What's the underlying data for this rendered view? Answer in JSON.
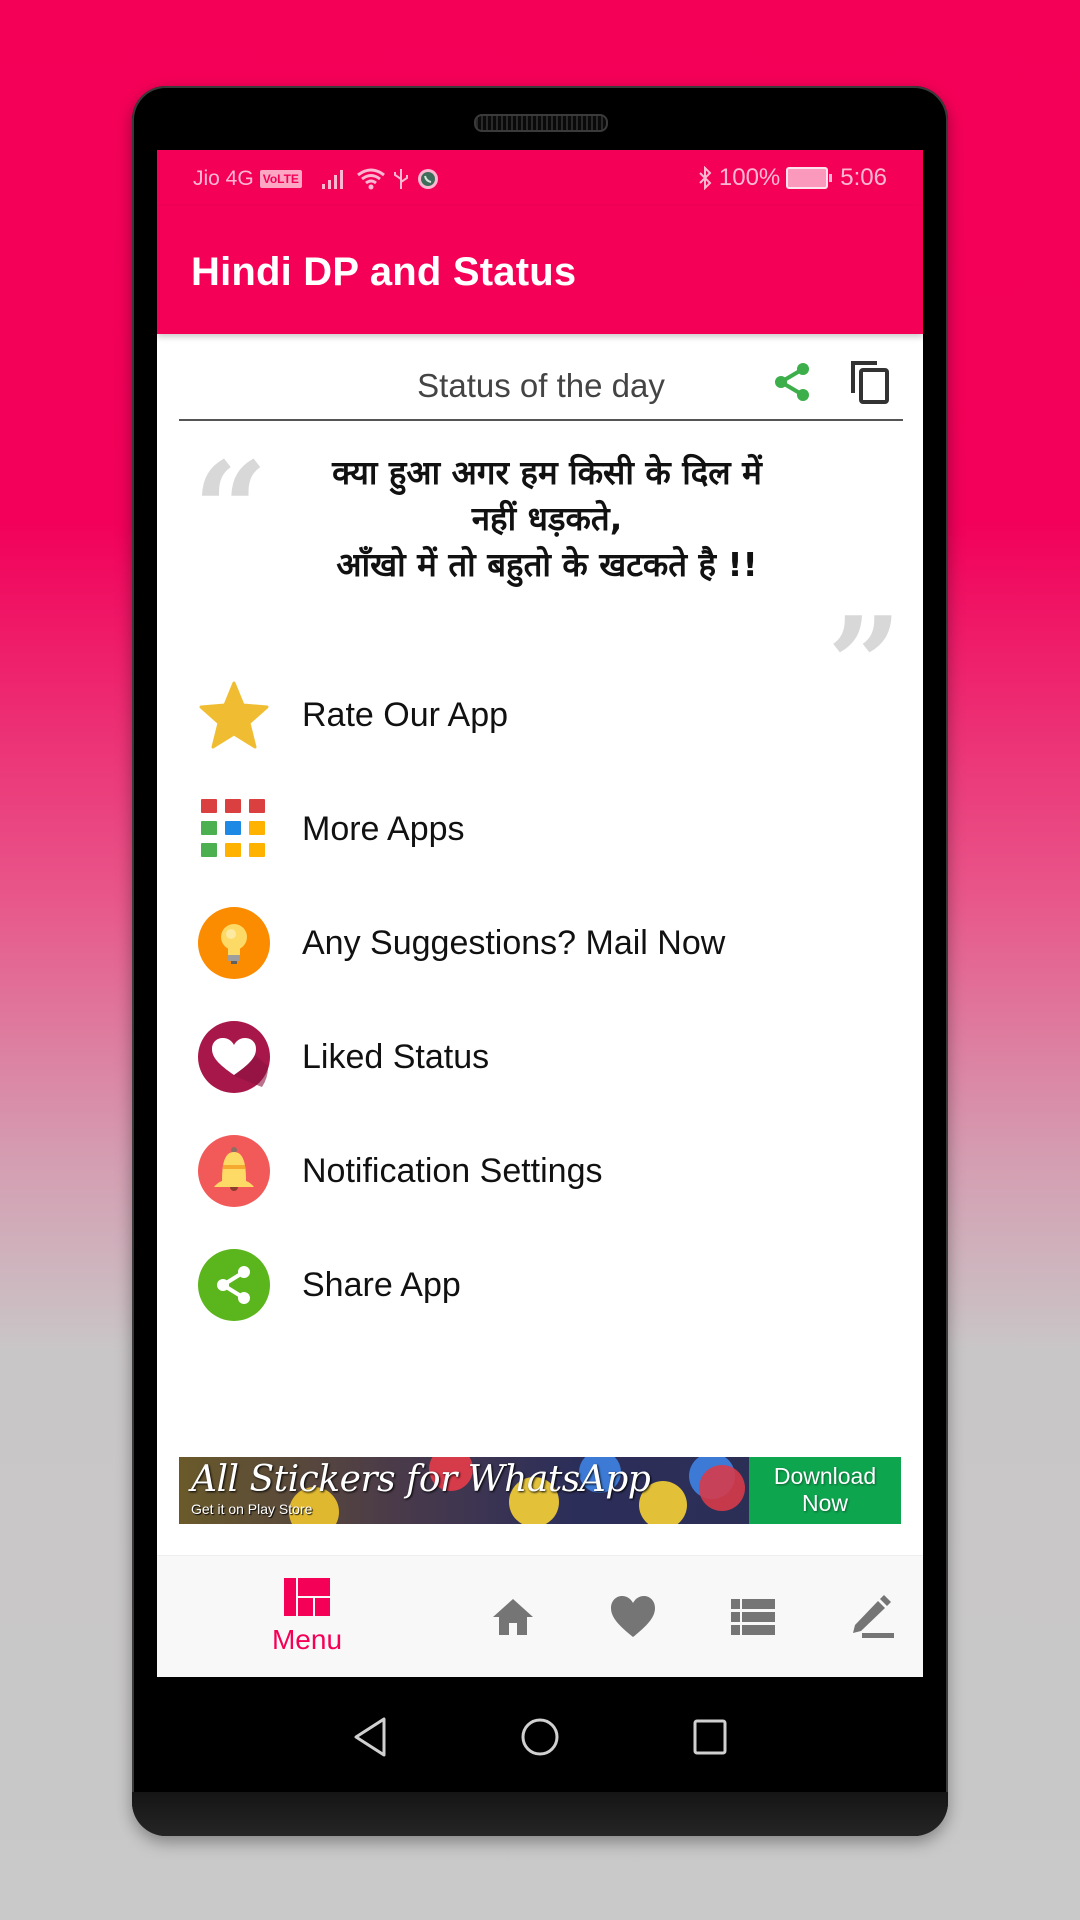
{
  "status_bar": {
    "carrier": "Jio 4G",
    "volte_badge": "VoLTE",
    "battery_text": "100%",
    "time": "5:06",
    "icons": [
      "signal-icon",
      "wifi-icon",
      "usb-icon",
      "whatsapp-icon",
      "bluetooth-icon",
      "battery-icon"
    ]
  },
  "app_bar": {
    "title": "Hindi DP and Status"
  },
  "status_of_day": {
    "label": "Status of the day",
    "share_icon": "share-icon",
    "copy_icon": "copy-icon",
    "quote_lines": [
      "क्या हुआ अगर हम किसी के दिल में",
      "नहीं धड़कते,",
      "आँखो में तो बहुतो के खटकते है !!"
    ]
  },
  "menu": {
    "items": [
      {
        "label": "Rate Our App",
        "icon": "star-icon"
      },
      {
        "label": "More Apps",
        "icon": "apps-grid-icon"
      },
      {
        "label": "Any Suggestions? Mail Now",
        "icon": "lightbulb-icon"
      },
      {
        "label": "Liked Status",
        "icon": "heart-icon"
      },
      {
        "label": "Notification Settings",
        "icon": "bell-icon"
      },
      {
        "label": "Share App",
        "icon": "share-icon"
      }
    ]
  },
  "ad_banner": {
    "title": "All Stickers for WhatsApp",
    "subtitle": "Get it on Play Store",
    "cta_line1": "Download",
    "cta_line2": "Now"
  },
  "bottom_nav": {
    "active": "Menu",
    "items": [
      {
        "label": "Menu",
        "icon": "dashboard-icon"
      },
      {
        "label": "",
        "icon": "home-icon"
      },
      {
        "label": "",
        "icon": "heart-icon"
      },
      {
        "label": "",
        "icon": "list-icon"
      },
      {
        "label": "",
        "icon": "edit-icon"
      }
    ]
  },
  "colors": {
    "primary": "#f50057",
    "share_green": "#3cae4a",
    "nav_inactive": "#757575",
    "cta_green": "#0ea54f"
  }
}
